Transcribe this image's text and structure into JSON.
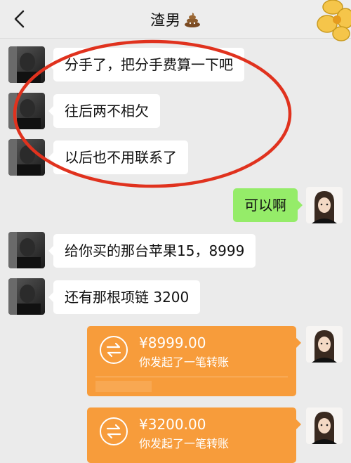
{
  "header": {
    "title": "渣男",
    "title_emoji": "💩"
  },
  "messages": [
    {
      "side": "left",
      "text": "分手了，把分手费算一下吧"
    },
    {
      "side": "left",
      "text": "往后两不相欠"
    },
    {
      "side": "left",
      "text": "以后也不用联系了"
    },
    {
      "side": "right",
      "text": "可以啊"
    },
    {
      "side": "left",
      "text": "给你买的那台苹果15，8999"
    },
    {
      "side": "left",
      "text": "还有那根项链 3200"
    }
  ],
  "transfers": [
    {
      "amount": "¥8999.00",
      "note": "你发起了一笔转账"
    },
    {
      "amount": "¥3200.00",
      "note": "你发起了一笔转账"
    }
  ],
  "colors": {
    "self_bubble": "#95ec69",
    "other_bubble": "#ffffff",
    "transfer": "#f79c3b",
    "annotation_circle": "#e0321e"
  }
}
